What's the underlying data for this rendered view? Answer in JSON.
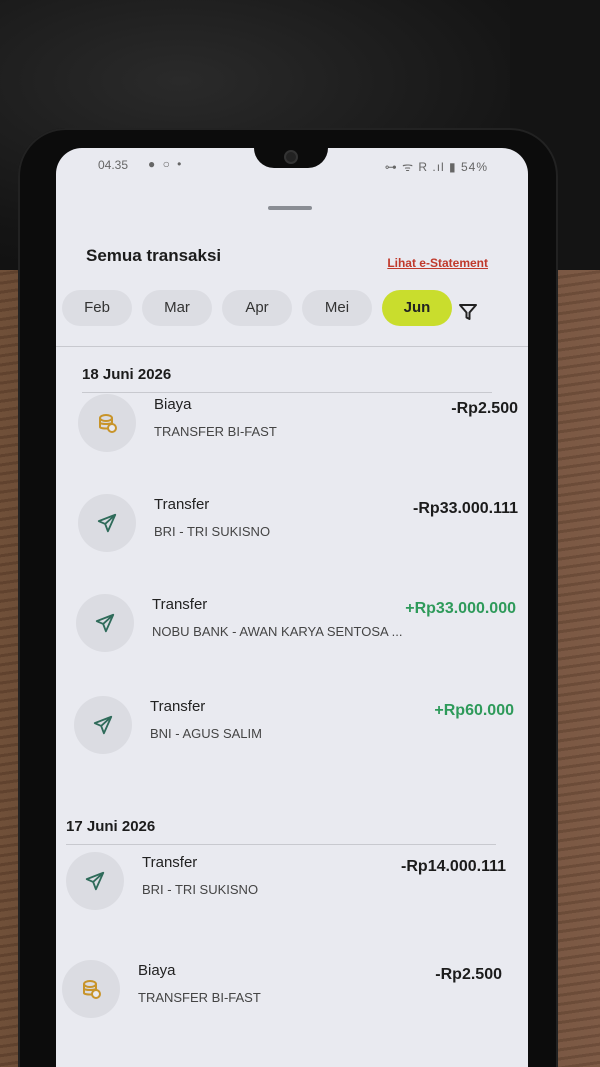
{
  "status_bar": {
    "time": "04.35",
    "indicators_left": "● ○ •",
    "indicators_right": "⊶ ᯤ R .ıl ▮ 54%"
  },
  "header": {
    "title": "Semua transaksi",
    "estatement_link": "Lihat e-Statement"
  },
  "months": [
    "Feb",
    "Mar",
    "Apr",
    "Mei",
    "Jun"
  ],
  "selected_month": "Jun",
  "groups": [
    {
      "date": "18 Juni 2026",
      "transactions": [
        {
          "type": "fee",
          "icon": "coins-icon",
          "title": "Biaya",
          "subtitle": "TRANSFER BI-FAST",
          "amount": "-Rp2.500",
          "direction": "out"
        },
        {
          "type": "transfer",
          "icon": "send-icon",
          "title": "Transfer",
          "subtitle": "BRI - TRI SUKISNO",
          "amount": "-Rp33.000.111",
          "direction": "out"
        },
        {
          "type": "transfer",
          "icon": "send-icon",
          "title": "Transfer",
          "subtitle": "NOBU BANK - AWAN KARYA SENTOSA ...",
          "amount": "+Rp33.000.000",
          "direction": "in"
        },
        {
          "type": "transfer",
          "icon": "send-icon",
          "title": "Transfer",
          "subtitle": "BNI - AGUS SALIM",
          "amount": "+Rp60.000",
          "direction": "in"
        }
      ]
    },
    {
      "date": "17 Juni 2026",
      "transactions": [
        {
          "type": "transfer",
          "icon": "send-icon",
          "title": "Transfer",
          "subtitle": "BRI - TRI SUKISNO",
          "amount": "-Rp14.000.111",
          "direction": "out"
        },
        {
          "type": "fee",
          "icon": "coins-icon",
          "title": "Biaya",
          "subtitle": "TRANSFER BI-FAST",
          "amount": "-Rp2.500",
          "direction": "out"
        }
      ]
    }
  ],
  "colors": {
    "positive_amount": "#2e9a5a",
    "active_month": "#c9dd2d",
    "link": "#c0392b",
    "icon_stroke_transfer": "#2f6b5a",
    "icon_coin": "#c8942a"
  }
}
